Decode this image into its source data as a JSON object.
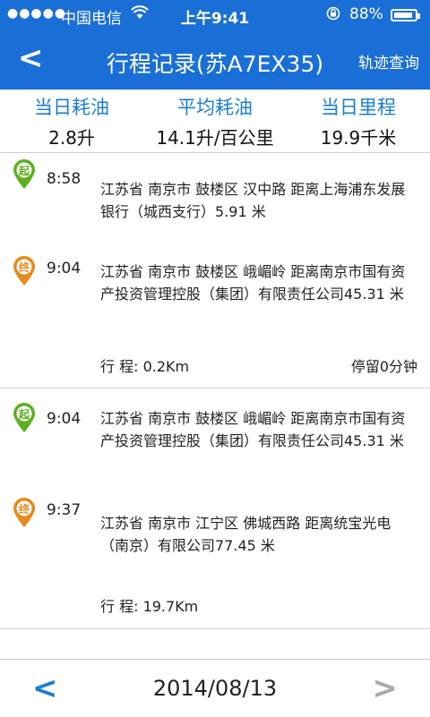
{
  "status_bar": {
    "signal": "●●●●●",
    "carrier": "中国电信",
    "time": "上午9:41",
    "battery": "88%"
  },
  "nav": {
    "back": "<",
    "title": "行程记录(苏A7EX35)",
    "track_query": "轨迹查询"
  },
  "stats": {
    "daily_fuel_label": "当日耗油",
    "daily_fuel_value": "2.8升",
    "avg_fuel_label": "平均耗油",
    "avg_fuel_value": "14.1升/百公里",
    "daily_mileage_label": "当日里程",
    "daily_mileage_value": "19.9千米"
  },
  "trips": [
    {
      "start_badge": "起",
      "start_time": "8:58",
      "start_address": "江苏省 南京市 鼓楼区 汉中路  距离上海浦东发展银行（城西支行）5.91 米",
      "end_badge": "终",
      "end_time": "9:04",
      "end_address": "江苏省 南京市 鼓楼区 峨嵋岭  距离南京市国有资产投资管理控股（集团）有限责任公司45.31 米",
      "distance": "行 程:  0.2Km",
      "stay": "停留0分钟"
    },
    {
      "start_badge": "起",
      "start_time": "9:04",
      "start_address": "江苏省 南京市 鼓楼区 峨嵋岭  距离南京市国有资产投资管理控股（集团）有限责任公司45.31 米",
      "end_badge": "终",
      "end_time": "9:37",
      "end_address": "江苏省 南京市 江宁区 佛城西路  距离统宝光电（南京）有限公司77.45 米",
      "distance": "行 程:  19.7Km"
    }
  ],
  "footer": {
    "prev": "<",
    "date": "2014/08/13",
    "next": ">"
  },
  "colors": {
    "header": "#1a6fd6",
    "accent": "#1a7fd0",
    "start_pin": "#5caf1e",
    "end_pin": "#e58a1b"
  }
}
